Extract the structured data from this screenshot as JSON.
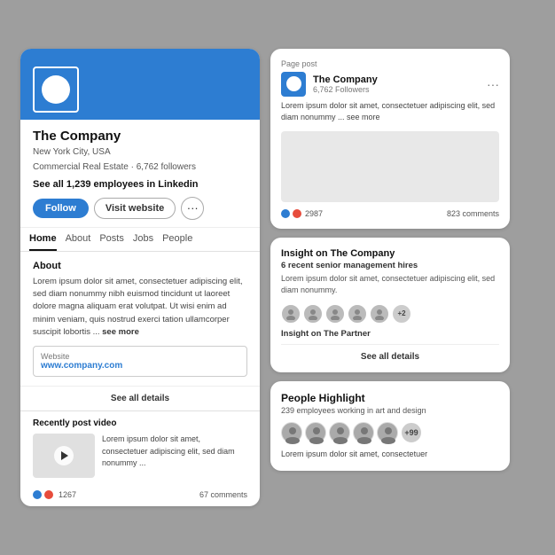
{
  "left": {
    "company_name": "The Company",
    "meta_line1": "New York City, USA",
    "meta_line2": "Commercial Real Estate · 6,762 followers",
    "employees_text": "See all 1,239 employees in Linkedin",
    "btn_follow": "Follow",
    "btn_visit": "Visit website",
    "nav": {
      "tabs": [
        {
          "label": "Home",
          "active": true
        },
        {
          "label": "About",
          "active": false
        },
        {
          "label": "Posts",
          "active": false
        },
        {
          "label": "Jobs",
          "active": false
        },
        {
          "label": "People",
          "active": false
        }
      ]
    },
    "about_title": "About",
    "about_text": "Lorem ipsum dolor sit amet, consectetuer adipiscing elit, sed diam nonummy nibh euismod tincidunt ut laoreet dolore magna aliquam erat volutpat. Ut wisi enim ad minim veniam, quis nostrud exerci tation ullamcorper suscipit lobortis ...",
    "see_more": "see more",
    "website_label": "Website",
    "website_url": "www.company.com",
    "see_all_details": "See all details",
    "video_section_title": "Recently post video",
    "video_text": "Lorem ipsum dolor sit amet, consectetuer adipiscing elit, sed diam nonummy ...",
    "video_stat_num": "1267",
    "video_comments": "67 comments"
  },
  "right": {
    "post_card": {
      "label": "Page post",
      "company_name": "The Company",
      "followers": "6,762 Followers",
      "body_text": "Lorem ipsum dolor sit amet, consectetuer adipiscing elit, sed diam nonummy ... see more",
      "stat_num": "2987",
      "comments": "823 comments"
    },
    "insight_card": {
      "title": "Insight on The Company",
      "subtitle": "6 recent senior management hires",
      "body_text": "Lorem ipsum dolor sit amet, consectetuer adipiscing elit, sed diam nonummy.",
      "avatar_plus": "+2",
      "partner_label": "Insight on The Partner",
      "see_all": "See all details"
    },
    "people_card": {
      "title": "People Highlight",
      "subtitle": "239 employees working in art and design",
      "avatar_plus": "+99",
      "body_text": "Lorem ipsum dolor sit amet, consectetuer"
    }
  }
}
